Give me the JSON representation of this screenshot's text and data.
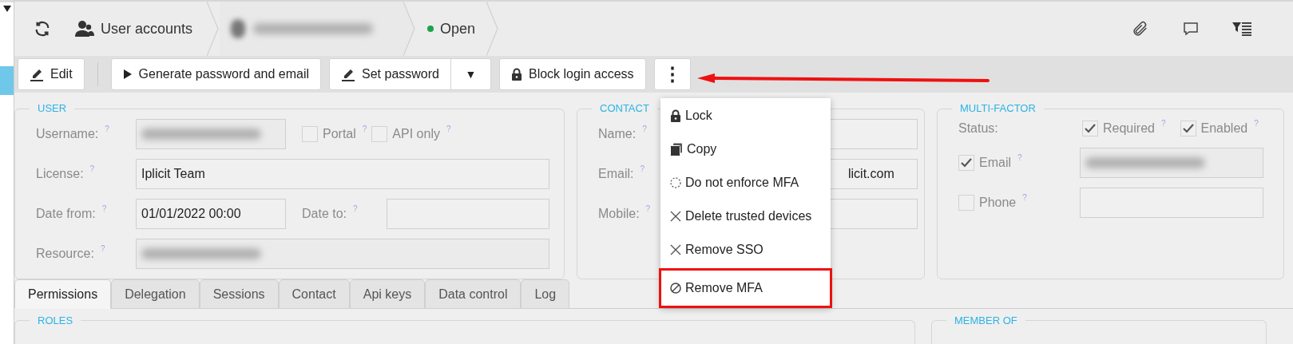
{
  "breadcrumb": {
    "module": "User accounts",
    "record": {
      "kind": "redacted"
    },
    "status": {
      "label": "Open",
      "color": "#1aa34a"
    }
  },
  "toolbar": [
    {
      "label": "Edit",
      "kind": "plain"
    },
    {
      "label": "Generate password and email",
      "kind": "plain"
    },
    {
      "label": "Set password",
      "kind": "split",
      "caret": "▼"
    },
    {
      "label": "Block login access",
      "kind": "plain"
    },
    {
      "label": "⋮",
      "kind": "more"
    }
  ],
  "menu": [
    {
      "label": "Lock",
      "highlighted": false
    },
    {
      "label": "Copy",
      "highlighted": false
    },
    {
      "label": "Do not enforce MFA",
      "highlighted": false
    },
    {
      "label": "Delete trusted devices",
      "highlighted": false
    },
    {
      "label": "Remove SSO",
      "highlighted": false
    },
    {
      "label": "Remove MFA",
      "highlighted": true
    }
  ],
  "user": {
    "title": "USER",
    "username": {
      "label": "Username:",
      "help": "?",
      "value": {
        "kind": "redacted"
      }
    },
    "portal": {
      "label": "Portal",
      "help": "?",
      "checked": false
    },
    "api_only": {
      "label": "API only",
      "help": "?",
      "checked": false
    },
    "license": {
      "label": "License:",
      "help": "?",
      "value": "Iplicit Team"
    },
    "date_from": {
      "label": "Date from:",
      "help": "?",
      "value": "01/01/2022 00:00"
    },
    "date_to": {
      "label": "Date to:",
      "help": "?"
    },
    "resource": {
      "label": "Resource:",
      "help": "?",
      "value": {
        "kind": "redacted"
      }
    }
  },
  "contact": {
    "title": "CONTACT",
    "fields": [
      {
        "label": "Name:",
        "help": "?"
      },
      {
        "label": "Email:",
        "help": "?",
        "value": "licit.com"
      },
      {
        "label": "Mobile:",
        "help": "?"
      }
    ]
  },
  "multi_factor": {
    "title": "MULTI-FACTOR",
    "status_label": "Status:",
    "status": [
      {
        "label": "Required",
        "help": "?",
        "checked": true
      },
      {
        "label": "Enabled",
        "help": "?",
        "checked": true
      }
    ],
    "methods": [
      {
        "label": "Email",
        "help": "?",
        "checked": true,
        "value": {
          "kind": "redacted"
        }
      },
      {
        "label": "Phone",
        "help": "?",
        "checked": false
      }
    ]
  },
  "tabs": [
    {
      "label": "Permissions",
      "selected": true
    },
    {
      "label": "Delegation",
      "selected": false
    },
    {
      "label": "Sessions",
      "selected": false
    },
    {
      "label": "Contact",
      "selected": false
    },
    {
      "label": "Api keys",
      "selected": false
    },
    {
      "label": "Data control",
      "selected": false
    },
    {
      "label": "Log",
      "selected": false
    }
  ],
  "sections": [
    "ROLES",
    "MEMBER OF"
  ]
}
